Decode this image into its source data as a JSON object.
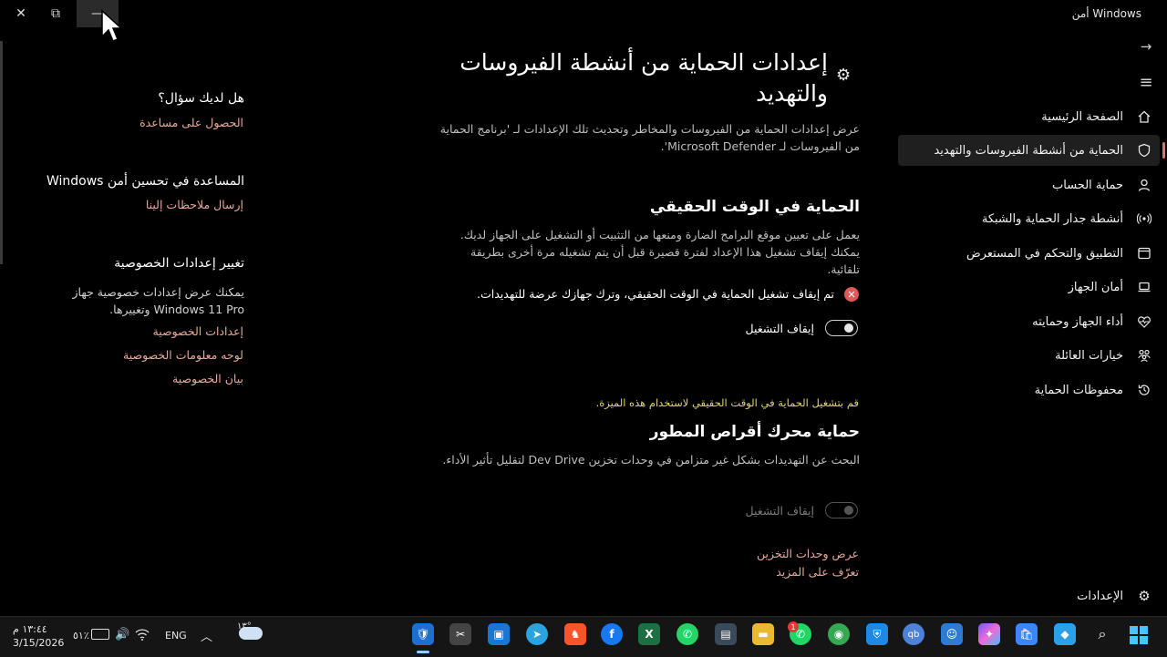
{
  "window": {
    "title": "أمن Windows",
    "close_glyph": "✕",
    "restore_glyph": "⧉",
    "minimize_glyph": "—"
  },
  "nav": {
    "back_glyph": "→",
    "menu_glyph": "≡",
    "items": [
      {
        "label": "الصفحة الرئيسية",
        "icon": "home-icon"
      },
      {
        "label": "الحماية من أنشطة الفيروسات والتهديد",
        "icon": "shield-icon"
      },
      {
        "label": "حماية الحساب",
        "icon": "person-icon"
      },
      {
        "label": "أنشطة جدار الحماية والشبكة",
        "icon": "wifi-icon"
      },
      {
        "label": "التطبيق والتحكم في المستعرض",
        "icon": "app-browser-icon"
      },
      {
        "label": "أمان الجهاز",
        "icon": "laptop-icon"
      },
      {
        "label": "أداء الجهاز وحمايته",
        "icon": "heart-icon"
      },
      {
        "label": "خيارات العائلة",
        "icon": "family-icon"
      },
      {
        "label": "محفوظات الحماية",
        "icon": "history-icon"
      }
    ],
    "settings_label": "الإعدادات"
  },
  "main": {
    "title": "إعدادات الحماية من أنشطة الفيروسات والتهديد",
    "description": "عرض إعدادات الحماية من الفيروسات والمخاطر وتحديث تلك الإعدادات لـ 'برنامج الحماية من الفيروسات لـ Microsoft Defender'.",
    "realtime": {
      "heading": "الحماية في الوقت الحقيقي",
      "description": "يعمل على تعيين موقع البرامج الضارة ومنعها من التثبيت أو التشغيل على الجهاز لديك. يمكنك إيقاف تشغيل هذا الإعداد لفترة قصيرة قبل أن يتم تشغيله مرة أخرى بطريقة تلقائية.",
      "error_text": "تم إيقاف تشغيل الحماية في الوقت الحقيقي، وترك جهازك عرضة للتهديدات.",
      "toggle_label": "إيقاف التشغيل"
    },
    "devdrive": {
      "warning": "قم بتشغيل الحماية في الوقت الحقيقي لاستخدام هذه الميزة.",
      "heading": "حماية محرك أقراص المطور",
      "description": "البحث عن التهديدات بشكل غير متزامن في وحدات تخزين Dev Drive لتقليل تأثير الأداء.",
      "toggle_label": "إيقاف التشغيل",
      "link_storage": "عرض وحدات التخزين",
      "link_learn": "تعرّف على المزيد"
    }
  },
  "side": {
    "question_heading": "هل لديك سؤال؟",
    "help_link": "الحصول على مساعدة",
    "improve_heading": "المساعدة في تحسين أمن Windows",
    "feedback_link": "إرسال ملاحظات إلينا",
    "privacy_heading": "تغيير إعدادات الخصوصية",
    "privacy_text": "يمكنك عرض إعدادات خصوصية جهاز Windows 11 Pro وتغييرها.",
    "privacy_links": [
      "إعدادات الخصوصية",
      "لوحه معلومات الخصوصية",
      "بيان الخصوصية"
    ]
  },
  "taskbar": {
    "time": "١٣:٤٤ م",
    "date": "3/15/2026",
    "battery": "٥١٪",
    "language": "ENG",
    "weather_temp": "١٣°",
    "notification_badge": "1",
    "apps": [
      "defender",
      "snipping",
      "store-app",
      "telegram",
      "brave",
      "facebook",
      "excel",
      "whatsapp",
      "terminal",
      "explorer",
      "whatsapp-business",
      "chrome",
      "shield",
      "qbittorrent",
      "feedback",
      "copilot",
      "ms-store",
      "widgets",
      "search",
      "start"
    ]
  }
}
